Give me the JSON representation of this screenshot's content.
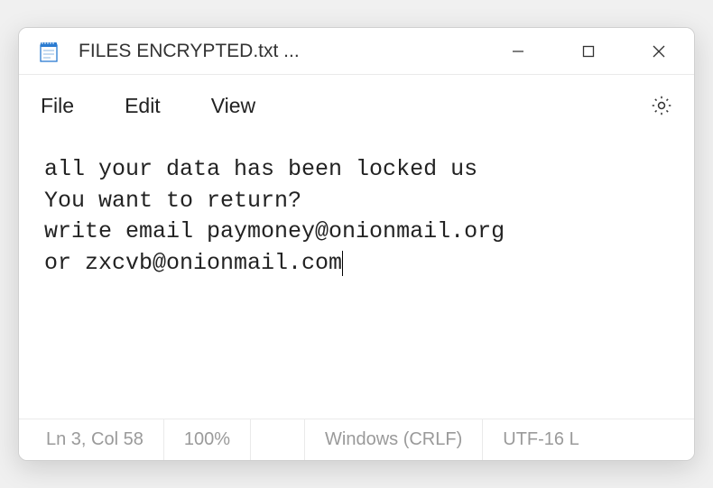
{
  "titlebar": {
    "title": "FILES ENCRYPTED.txt ...",
    "app_icon": "notepad-icon"
  },
  "menubar": {
    "file": "File",
    "edit": "Edit",
    "view": "View"
  },
  "editor": {
    "line1": "all your data has been locked us",
    "line2": "You want to return?",
    "line3": "write email paymoney@onionmail.org",
    "line4": "or zxcvb@onionmail.com"
  },
  "statusbar": {
    "position": "Ln 3, Col 58",
    "zoom": "100%",
    "line_ending": "Windows (CRLF)",
    "encoding": "UTF-16 L"
  }
}
